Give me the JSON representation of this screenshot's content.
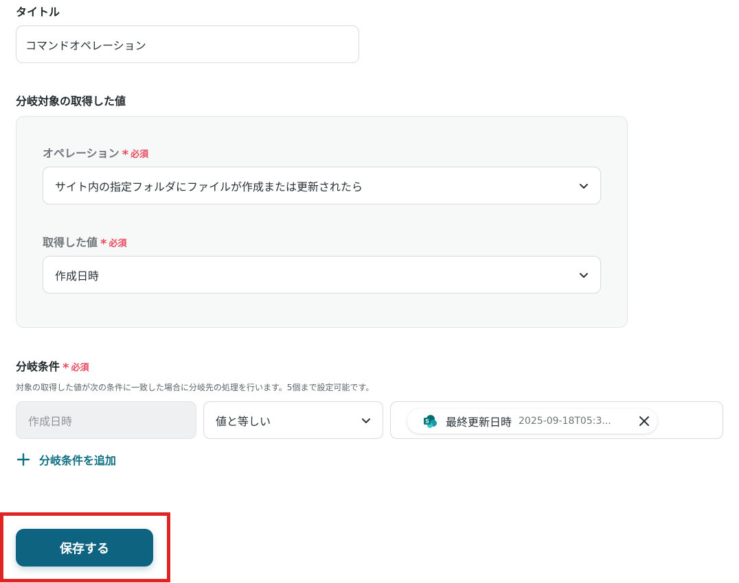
{
  "title_section": {
    "label": "タイトル",
    "value": "コマンドオペレーション"
  },
  "branch_target": {
    "label": "分岐対象の取得した値",
    "operation": {
      "label": "オペレーション",
      "required": "必須",
      "value": "サイト内の指定フォルダにファイルが作成または更新されたら"
    },
    "acquired_value": {
      "label": "取得した値",
      "required": "必須",
      "value": "作成日時"
    }
  },
  "branch_condition": {
    "label": "分岐条件",
    "required": "必須",
    "helper": "対象の取得した値が次の条件に一致した場合に分岐先の処理を行います。5個まで設定可能です。",
    "field": "作成日時",
    "operator": "値と等しい",
    "chip": {
      "icon": "sharepoint-icon",
      "name": "最終更新日時",
      "value": "2025-09-18T05:3..."
    },
    "add_label": "分岐条件を追加"
  },
  "save_button": {
    "label": "保存する"
  },
  "colors": {
    "accent": "#0e6480",
    "link": "#0e6e84",
    "required": "#e84a5f",
    "highlight": "#e02424"
  }
}
